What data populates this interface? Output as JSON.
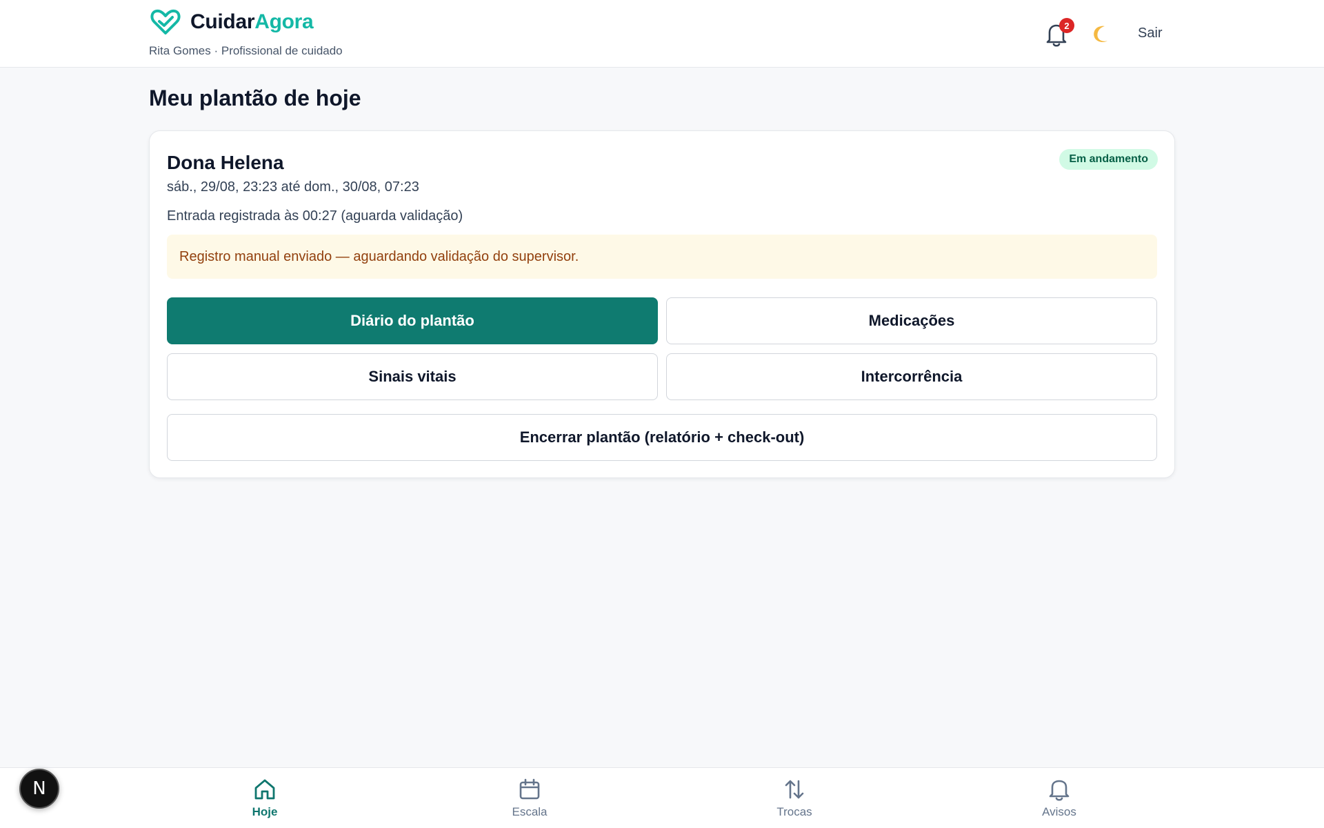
{
  "header": {
    "brand_part1": "Cuidar",
    "brand_part2": "Agora",
    "subtitle": "Rita Gomes · Profissional de cuidado",
    "notification_count": "2",
    "logout_label": "Sair",
    "icons": [
      "heart-logo-icon",
      "bell-icon",
      "moon-icon"
    ]
  },
  "main": {
    "page_title": "Meu plantão de hoje",
    "shift": {
      "patient_name": "Dona Helena",
      "status": "Em andamento",
      "period": "sáb., 29/08, 23:23 até dom., 30/08, 07:23",
      "entry_info": "Entrada registrada às 00:27 (aguarda validação)",
      "alert": "Registro manual enviado — aguardando validação do supervisor."
    },
    "actions": {
      "diary": "Diário do plantão",
      "medications": "Medicações",
      "vitals": "Sinais vitais",
      "incident": "Intercorrência",
      "end_shift": "Encerrar plantão (relatório + check-out)"
    }
  },
  "bottom_nav": {
    "items": [
      {
        "label": "Hoje",
        "icon": "home-icon",
        "active": true
      },
      {
        "label": "Escala",
        "icon": "calendar-icon",
        "active": false
      },
      {
        "label": "Trocas",
        "icon": "swap-arrows-icon",
        "active": false
      },
      {
        "label": "Avisos",
        "icon": "bell-icon",
        "active": false
      }
    ]
  },
  "dev_badge": {
    "letter": "N"
  },
  "colors": {
    "primary": "#0f7b70",
    "brand_accent": "#14b8a6",
    "status_bg": "#d1fae5",
    "alert_bg": "#fef9e7",
    "alert_text": "#92400e",
    "notification_badge": "#dc2626"
  }
}
